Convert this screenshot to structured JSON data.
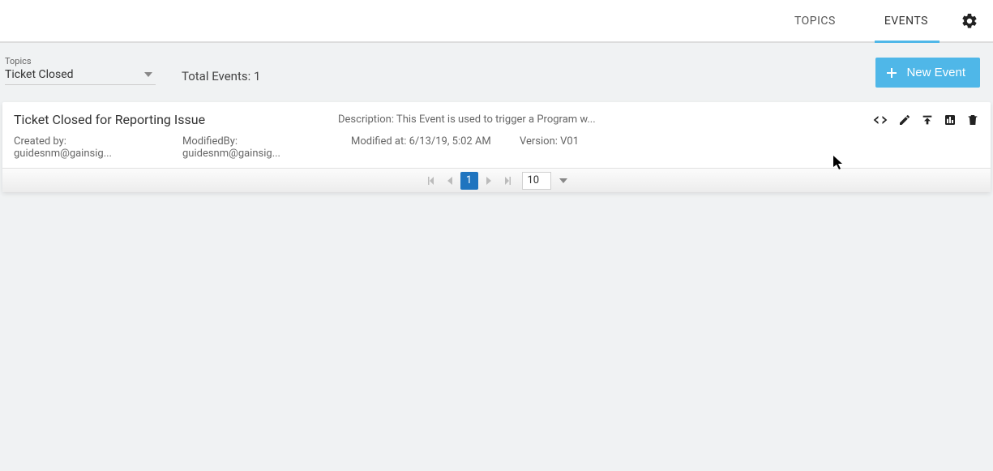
{
  "header": {
    "tabs": {
      "topics": "TOPICS",
      "events": "EVENTS"
    }
  },
  "toolbar": {
    "topics_label": "Topics",
    "topics_value": "Ticket Closed",
    "total_events_label": "Total Events: 1",
    "new_event_label": "New Event"
  },
  "events": [
    {
      "title": "Ticket Closed for Reporting Issue",
      "description": "Description: This Event is used to trigger a Program w...",
      "created_by": "Created by: guidesnm@gainsig...",
      "modified_by": "ModifiedBy: guidesnm@gainsig...",
      "modified_at": "Modified at: 6/13/19, 5:02 AM",
      "version": "Version: V01"
    }
  ],
  "pagination": {
    "current": "1",
    "page_size": "10"
  }
}
